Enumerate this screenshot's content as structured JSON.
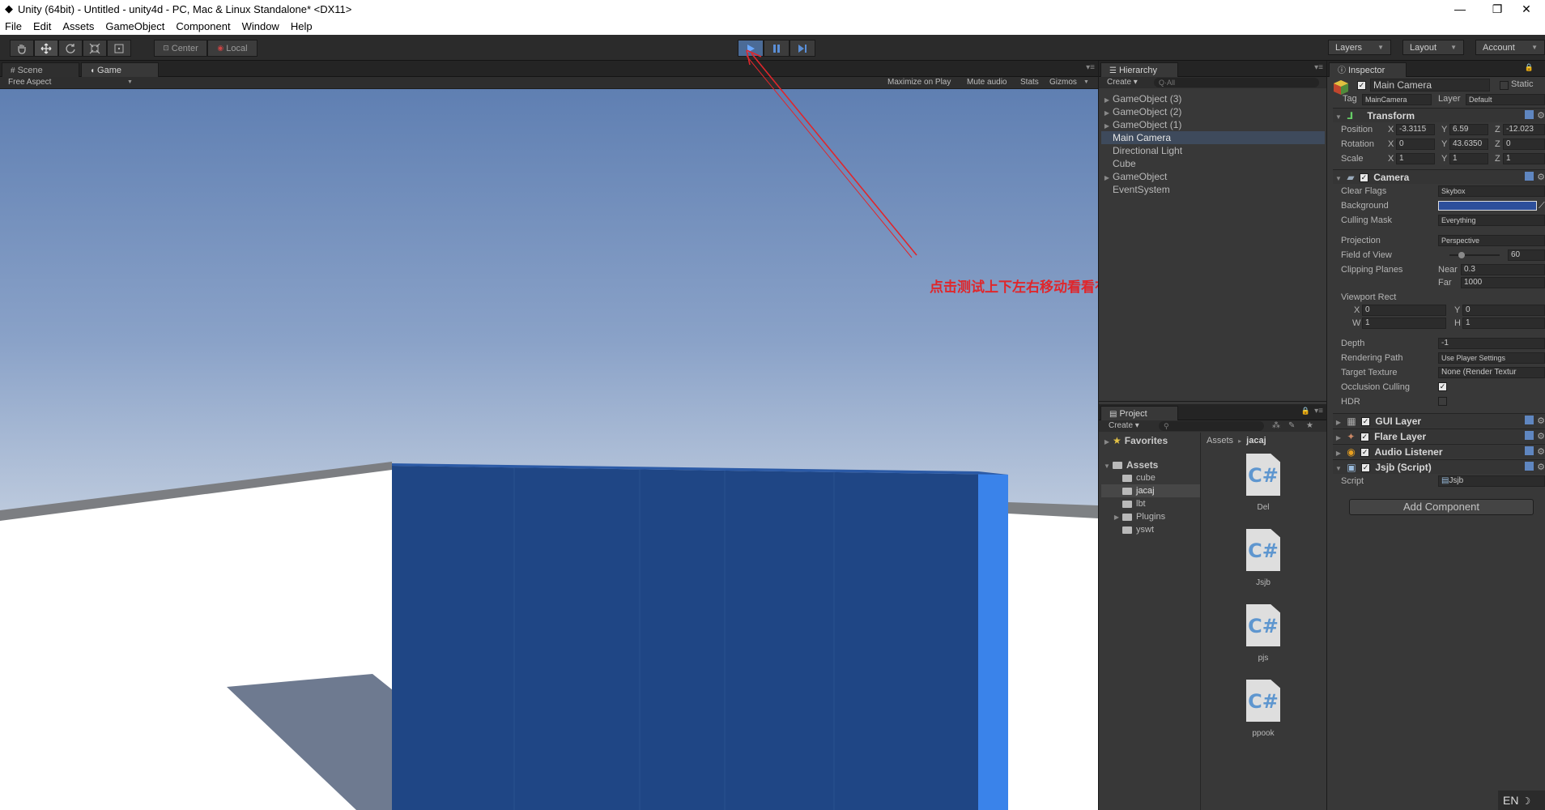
{
  "window": {
    "title": "Unity (64bit) - Untitled - unity4d - PC, Mac & Linux Standalone* <DX11>",
    "controls": [
      "—",
      "❐",
      "✕"
    ]
  },
  "menu": [
    "File",
    "Edit",
    "Assets",
    "GameObject",
    "Component",
    "Window",
    "Help"
  ],
  "toolbar": {
    "pivot": "Center",
    "space": "Local",
    "layers": "Layers",
    "layout": "Layout",
    "account": "Account"
  },
  "scene_tabs": [
    {
      "label": "Scene",
      "active": false
    },
    {
      "label": "Game",
      "active": true
    }
  ],
  "game_bar": {
    "aspect": "Free Aspect",
    "maximize": "Maximize on Play",
    "mute": "Mute audio",
    "stats": "Stats",
    "gizmos": "Gizmos"
  },
  "annotation": "点击测试上下左右移动看看有问题",
  "annotation_color": "#e0262b",
  "hierarchy": {
    "title": "Hierarchy",
    "create": "Create",
    "search": "Q·All",
    "items": [
      {
        "label": "GameObject (3)",
        "expandable": true,
        "selected": false
      },
      {
        "label": "GameObject (2)",
        "expandable": true,
        "selected": false
      },
      {
        "label": "GameObject (1)",
        "expandable": true,
        "selected": false
      },
      {
        "label": "Main Camera",
        "expandable": false,
        "selected": true
      },
      {
        "label": "Directional Light",
        "expandable": false,
        "selected": false
      },
      {
        "label": "Cube",
        "expandable": false,
        "selected": false
      },
      {
        "label": "GameObject",
        "expandable": true,
        "selected": false
      },
      {
        "label": "EventSystem",
        "expandable": false,
        "selected": false
      }
    ]
  },
  "project": {
    "title": "Project",
    "create": "Create",
    "favorites": "Favorites",
    "assets_root": "Assets",
    "folders": [
      "cube",
      "jacaj",
      "lbt",
      "Plugins",
      "yswt"
    ],
    "breadcrumb_root": "Assets",
    "breadcrumb_current": "jacaj",
    "files": [
      "Del",
      "Jsjb",
      "pjs",
      "ppook"
    ]
  },
  "inspector": {
    "title": "Inspector",
    "object_name": "Main Camera",
    "static": "Static",
    "tag_label": "Tag",
    "tag_value": "MainCamera",
    "layer_label": "Layer",
    "layer_value": "Default",
    "transform": {
      "title": "Transform",
      "position_label": "Position",
      "position": {
        "x": "-3.3115",
        "y": "6.59",
        "z": "-12.023"
      },
      "rotation_label": "Rotation",
      "rotation": {
        "x": "0",
        "y": "43.6350",
        "z": "0"
      },
      "scale_label": "Scale",
      "scale": {
        "x": "1",
        "y": "1",
        "z": "1"
      }
    },
    "camera": {
      "title": "Camera",
      "clear_flags_label": "Clear Flags",
      "clear_flags": "Skybox",
      "background_label": "Background",
      "background_color": "#2d4f9b",
      "culling_label": "Culling Mask",
      "culling": "Everything",
      "projection_label": "Projection",
      "projection": "Perspective",
      "fov_label": "Field of View",
      "fov": "60",
      "clipping_label": "Clipping Planes",
      "near_label": "Near",
      "near": "0.3",
      "far_label": "Far",
      "far": "1000",
      "viewport_label": "Viewport Rect",
      "vx": "0",
      "vy": "0",
      "vw": "1",
      "vh": "1",
      "depth_label": "Depth",
      "depth": "-1",
      "rendering_label": "Rendering Path",
      "rendering": "Use Player Settings",
      "target_label": "Target Texture",
      "target": "None (Render Textur",
      "occlusion_label": "Occlusion Culling",
      "hdr_label": "HDR"
    },
    "gui_layer": "GUI Layer",
    "flare_layer": "Flare Layer",
    "audio_listener": "Audio Listener",
    "script_comp": "Jsjb (Script)",
    "script_label": "Script",
    "script_value": "Jsjb",
    "add_component": "Add Component"
  },
  "ime": "EN"
}
